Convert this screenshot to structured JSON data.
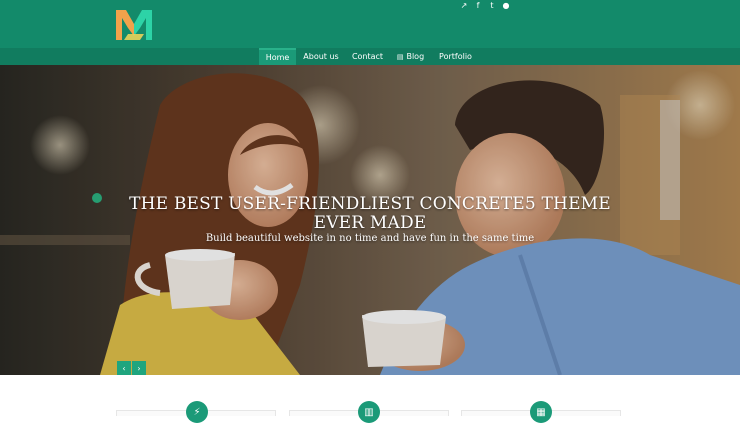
{
  "brand": {
    "logo_icon": "m-logo-icon"
  },
  "social": [
    {
      "icon": "external-link-icon",
      "glyph": "↗"
    },
    {
      "icon": "facebook-icon",
      "glyph": "f"
    },
    {
      "icon": "twitter-icon",
      "glyph": "t"
    },
    {
      "icon": "flickr-icon",
      "glyph": "●"
    }
  ],
  "nav": {
    "items": [
      {
        "label": "Home",
        "active": true
      },
      {
        "label": "About us"
      },
      {
        "label": "Contact"
      },
      {
        "label": "Blog",
        "icon": "blog-icon",
        "glyph": "▤"
      },
      {
        "label": "Portfolio"
      }
    ]
  },
  "hero": {
    "title": "THE BEST USER-FRIENDLIEST CONCRETE5 THEME EVER MADE",
    "subtitle": "Build beautiful website in no time and have fun in the same time",
    "prev_glyph": "‹",
    "next_glyph": "›"
  },
  "features": [
    {
      "icon": "lightning-icon",
      "glyph": "⚡"
    },
    {
      "icon": "buildings-icon",
      "glyph": "▥"
    },
    {
      "icon": "archive-icon",
      "glyph": "▦"
    }
  ],
  "colors": {
    "header": "#138a6a",
    "accent": "#1b9a78",
    "logo_orange": "#f2a24b",
    "logo_teal": "#2dd3a7"
  }
}
